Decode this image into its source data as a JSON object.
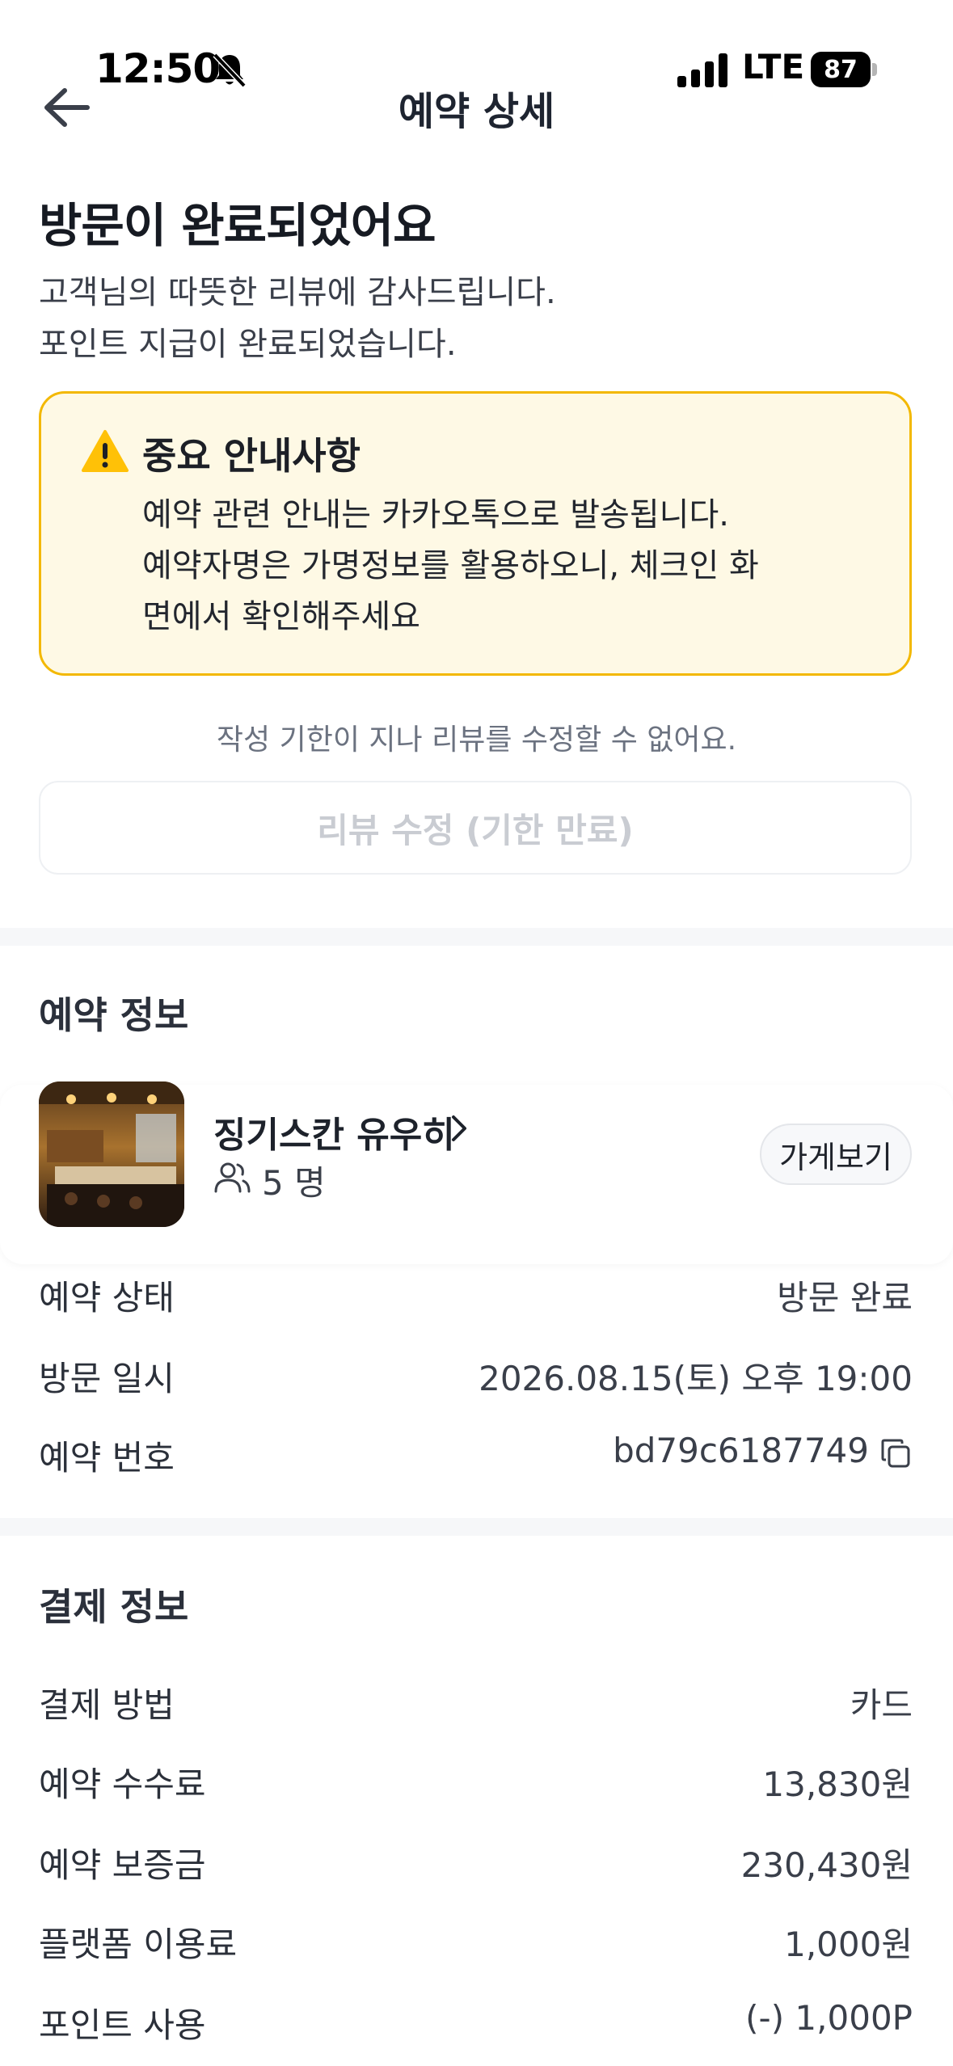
{
  "status_bar": {
    "time": "12:50",
    "network": "LTE",
    "battery": "87"
  },
  "nav": {
    "title": "예약 상세"
  },
  "header": {
    "title": "방문이 완료되었어요",
    "subtitle_line1": "고객님의 따뜻한 리뷰에 감사드립니다.",
    "subtitle_line2": "포인트 지급이 완료되었습니다."
  },
  "notice": {
    "title": "중요 안내사항",
    "line1": "예약 관련 안내는 카카오톡으로 발송됩니다.",
    "line2": "예약자명은 가명정보를 활용하오니, 체크인 화",
    "line3": "면에서 확인해주세요"
  },
  "review": {
    "deadline_text": "작성 기한이 지나 리뷰를 수정할 수 없어요.",
    "button_label": "리뷰 수정 (기한 만료)"
  },
  "reservation": {
    "section_title": "예약 정보",
    "store_name": "징기스칸 유우히",
    "party_size": "5 명",
    "store_button": "가게보기",
    "rows": [
      {
        "label": "예약 상태",
        "value": "방문 완료"
      },
      {
        "label": "방문 일시",
        "value": "2026.08.15(토) 오후 19:00"
      },
      {
        "label": "예약 번호",
        "value": "bd79c6187749"
      }
    ]
  },
  "payment": {
    "section_title": "결제 정보",
    "rows": [
      {
        "label": "결제 방법",
        "value": "카드"
      },
      {
        "label": "예약 수수료",
        "value": "13,830원"
      },
      {
        "label": "예약 보증금",
        "value": "230,430원"
      },
      {
        "label": "플랫폼 이용료",
        "value": "1,000원"
      },
      {
        "label": "포인트 사용",
        "value": "(-) 1,000P"
      }
    ]
  },
  "colors": {
    "notice_bg": "#fef9e5",
    "notice_border": "#f3b800",
    "warning": "#ffc107"
  },
  "icons": [
    "bell-slash-icon",
    "signal-icon",
    "battery-icon",
    "back-arrow-icon",
    "warning-icon",
    "chevron-right-icon",
    "people-icon",
    "copy-icon"
  ]
}
